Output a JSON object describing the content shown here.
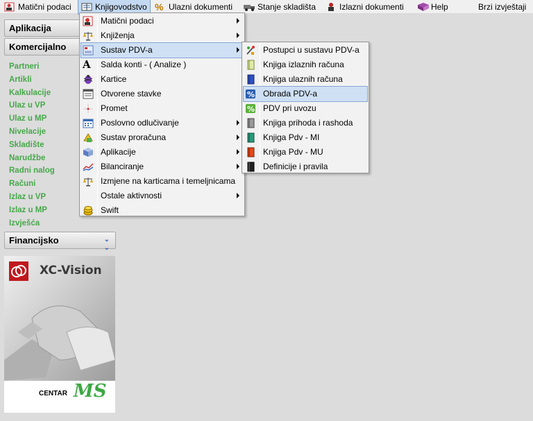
{
  "menubar": {
    "items": [
      {
        "label": "Matični podaci",
        "icon": "person-card-icon"
      },
      {
        "label": "Knjigovodstvo",
        "icon": "ledger-icon"
      },
      {
        "label": "Ulazni dokumenti",
        "icon": "percent-icon"
      },
      {
        "label": "Stanje skladišta",
        "icon": "truck-icon"
      },
      {
        "label": "Izlazni dokumenti",
        "icon": "worker-icon"
      },
      {
        "label": "Help",
        "icon": "help-book-icon"
      },
      {
        "label": "Brzi izvještaji",
        "icon": ""
      }
    ]
  },
  "sidebar": {
    "sections": {
      "aplikacija": "Aplikacija",
      "komercijalno": "Komercijalno",
      "financijsko": "Financijsko"
    },
    "links": [
      "Partneri",
      "Artikli",
      "Kalkulacije",
      "Ulaz u VP",
      "Ulaz u MP",
      "Nivelacije",
      "Skladište",
      "Narudžbe",
      "Radni nalog",
      "Računi",
      "Izlaz u VP",
      "Izlaz u MP",
      "Izvješća"
    ],
    "link_color": "#46a84a"
  },
  "menu_knjigovodstvo": {
    "items": [
      {
        "label": "Matični podaci",
        "icon": "person-card-icon",
        "submenu": true
      },
      {
        "label": "Knjiženja",
        "icon": "scales-icon",
        "submenu": true
      },
      {
        "label": "Sustav PDV-a",
        "icon": "tax-form-icon",
        "submenu": true,
        "highlighted": true
      },
      {
        "label": "Salda konti - ( Analize )",
        "icon": "letter-a-icon",
        "submenu": false
      },
      {
        "label": "Kartice",
        "icon": "bug-icon",
        "submenu": false
      },
      {
        "label": "Otvorene stavke",
        "icon": "list-window-icon",
        "submenu": false
      },
      {
        "label": "Promet",
        "icon": "crosshair-icon",
        "submenu": false
      },
      {
        "label": "Poslovno odlučivanje",
        "icon": "calendar-grid-icon",
        "submenu": true
      },
      {
        "label": "Sustav proračuna",
        "icon": "calculator-icon",
        "submenu": true
      },
      {
        "label": "Aplikacije",
        "icon": "cube-icon",
        "submenu": true
      },
      {
        "label": "Bilanciranje",
        "icon": "chart-line-icon",
        "submenu": true
      },
      {
        "label": "Izmjene na karticama i temeljnicama",
        "icon": "scales-icon",
        "submenu": false
      },
      {
        "label": "Ostale aktivnosti",
        "icon": "",
        "submenu": true
      },
      {
        "label": "Swift",
        "icon": "coins-icon",
        "submenu": false
      }
    ]
  },
  "menu_pdv": {
    "items": [
      {
        "label": "Postupci u sustavu PDV-a",
        "icon": "tools-icon",
        "highlighted": false
      },
      {
        "label": "Knjiga izlaznih računa",
        "icon": "book-green-icon",
        "highlighted": false
      },
      {
        "label": "Knjiga ulaznih računa",
        "icon": "book-blue-icon",
        "highlighted": false
      },
      {
        "label": "Obrada PDV-a",
        "icon": "percent-blue-icon",
        "highlighted": true
      },
      {
        "label": "PDV pri uvozu",
        "icon": "percent-green-icon",
        "highlighted": false
      },
      {
        "label": "Knjiga prihoda i rashoda",
        "icon": "book-gray-icon",
        "highlighted": false
      },
      {
        "label": "Knjiga Pdv - MI",
        "icon": "book-teal-icon",
        "highlighted": false
      },
      {
        "label": "Knjiga Pdv - MU",
        "icon": "book-red-icon",
        "highlighted": false
      },
      {
        "label": "Definicije i pravila",
        "icon": "book-black-icon",
        "highlighted": false
      }
    ]
  },
  "logo": {
    "brand": "XC-Vision",
    "footer_text": "CENTAR",
    "footer_mark": "MS"
  }
}
